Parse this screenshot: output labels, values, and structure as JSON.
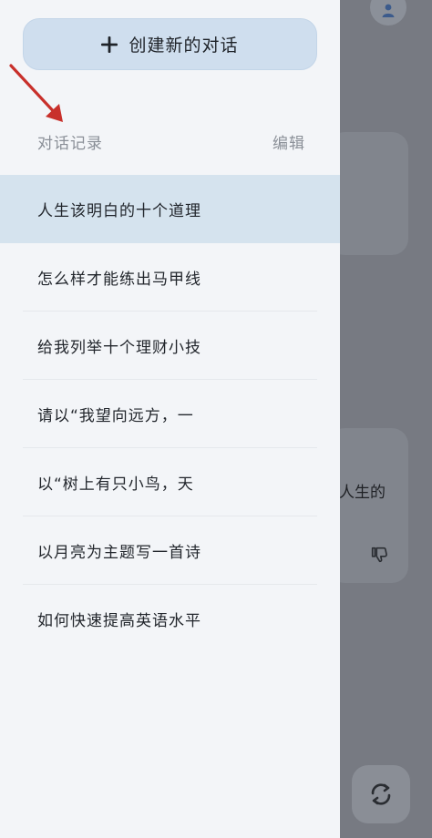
{
  "drawer": {
    "new_chat_label": "创建新的对话",
    "section_title": "对话记录",
    "edit_label": "编辑",
    "history": [
      {
        "title": "人生该明白的十个道理",
        "active": true
      },
      {
        "title": "怎么样才能练出马甲线",
        "active": false
      },
      {
        "title": "给我列举十个理财小技",
        "active": false
      },
      {
        "title": "请以“我望向远方，一",
        "active": false
      },
      {
        "title": "以“树上有只小鸟，天",
        "active": false
      },
      {
        "title": "以月亮为主题写一首诗",
        "active": false
      },
      {
        "title": "如何快速提高英语水平",
        "active": false
      }
    ]
  },
  "background": {
    "partial_text": "人生的"
  },
  "colors": {
    "drawer_bg": "#f3f5f8",
    "button_bg": "#cfdeee",
    "active_row_bg": "#d5e3ee",
    "annotation_arrow": "#c8302b",
    "overlay": "#777a82"
  },
  "icons": {
    "new_chat": "plus-icon",
    "annotation": "red-arrow-icon",
    "avatar": "user-icon",
    "dislike": "thumbs-down-icon",
    "refresh": "refresh-icon"
  }
}
